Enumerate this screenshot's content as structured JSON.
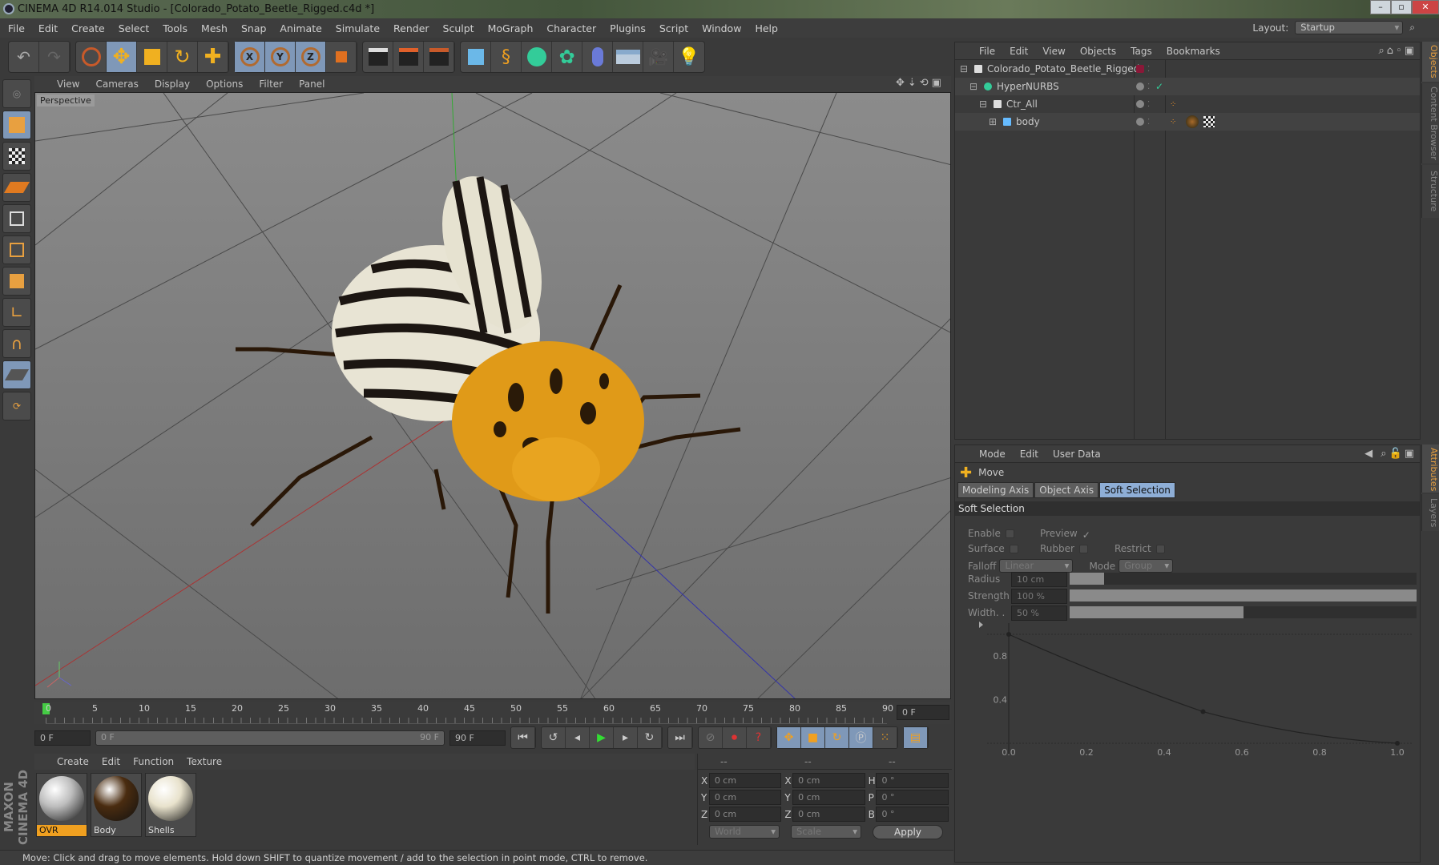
{
  "window": {
    "title": "CINEMA 4D R14.014 Studio - [Colorado_Potato_Beetle_Rigged.c4d *]",
    "minimize": "–",
    "maximize": "▫",
    "close": "✕"
  },
  "menu": [
    "File",
    "Edit",
    "Create",
    "Select",
    "Tools",
    "Mesh",
    "Snap",
    "Animate",
    "Simulate",
    "Render",
    "Sculpt",
    "MoGraph",
    "Character",
    "Plugins",
    "Script",
    "Window",
    "Help"
  ],
  "layout": {
    "label": "Layout:",
    "value": "Startup"
  },
  "viewport": {
    "menu": [
      "View",
      "Cameras",
      "Display",
      "Options",
      "Filter",
      "Panel"
    ],
    "camera_label": "Perspective"
  },
  "timeline": {
    "ticks": [
      "0",
      "5",
      "10",
      "15",
      "20",
      "25",
      "30",
      "35",
      "40",
      "45",
      "50",
      "55",
      "60",
      "65",
      "70",
      "75",
      "80",
      "85",
      "90"
    ],
    "current_frame": "0 F",
    "start": "0 F",
    "range_start": "0 F",
    "range_end": "90 F",
    "end": "90 F"
  },
  "materials": {
    "menu": [
      "Create",
      "Edit",
      "Function",
      "Texture"
    ],
    "items": [
      {
        "name": "OVR",
        "color": "#bdbdbd"
      },
      {
        "name": "Body",
        "color": "#4a2c10"
      },
      {
        "name": "Shells",
        "color": "#e8e2cc"
      }
    ]
  },
  "coords": {
    "headers": [
      "--",
      "--",
      "--"
    ],
    "rows": [
      {
        "a": "X",
        "av": "0 cm",
        "b": "X",
        "bv": "0 cm",
        "c": "H",
        "cv": "0 °"
      },
      {
        "a": "Y",
        "av": "0 cm",
        "b": "Y",
        "bv": "0 cm",
        "c": "P",
        "cv": "0 °"
      },
      {
        "a": "Z",
        "av": "0 cm",
        "b": "Z",
        "bv": "0 cm",
        "c": "B",
        "cv": "0 °"
      }
    ],
    "space": "World",
    "mode": "Scale",
    "apply": "Apply"
  },
  "status": "Move: Click and drag to move elements. Hold down SHIFT to quantize movement / add to the selection in point mode, CTRL to remove.",
  "objects": {
    "menu": [
      "File",
      "Edit",
      "View",
      "Objects",
      "Tags",
      "Bookmarks"
    ],
    "tree": [
      {
        "name": "Colorado_Potato_Beetle_Rigged",
        "indent": 0,
        "expander": "⊟"
      },
      {
        "name": "HyperNURBS",
        "indent": 1,
        "expander": "⊟"
      },
      {
        "name": "Ctr_All",
        "indent": 2,
        "expander": "⊟"
      },
      {
        "name": "body",
        "indent": 3,
        "expander": "⊞"
      }
    ]
  },
  "attributes": {
    "menu": [
      "Mode",
      "Edit",
      "User Data"
    ],
    "tool": "Move",
    "tabs": [
      "Modeling Axis",
      "Object Axis",
      "Soft Selection"
    ],
    "active_tab": "Soft Selection",
    "section": "Soft Selection",
    "enable": "Enable",
    "preview": "Preview",
    "surface": "Surface",
    "rubber": "Rubber",
    "restrict": "Restrict",
    "falloff_label": "Falloff",
    "falloff": "Linear",
    "mode_label": "Mode",
    "mode": "Group",
    "radius_label": "Radius",
    "radius": "10 cm",
    "radius_fraction": 0.1,
    "strength_label": "Strength",
    "strength": "100 %",
    "strength_fraction": 1.0,
    "width_label": "Width. .",
    "width": "50 %",
    "width_fraction": 0.5
  },
  "right_tabs": {
    "objects": "Objects",
    "content": "Content Browser",
    "structure": "Structure",
    "attributes": "Attributes",
    "layers": "Layers"
  },
  "chart_data": {
    "type": "line",
    "title": "Soft Selection falloff",
    "x": [
      0,
      0.5,
      1.0
    ],
    "y": [
      1.0,
      0.29,
      0.0
    ],
    "xticks": [
      "0.0",
      "0.2",
      "0.4",
      "0.6",
      "0.8",
      "1.0"
    ],
    "yticks": [
      "0.4",
      "0.8"
    ],
    "xlim": [
      0,
      1
    ],
    "ylim": [
      0,
      1
    ]
  }
}
